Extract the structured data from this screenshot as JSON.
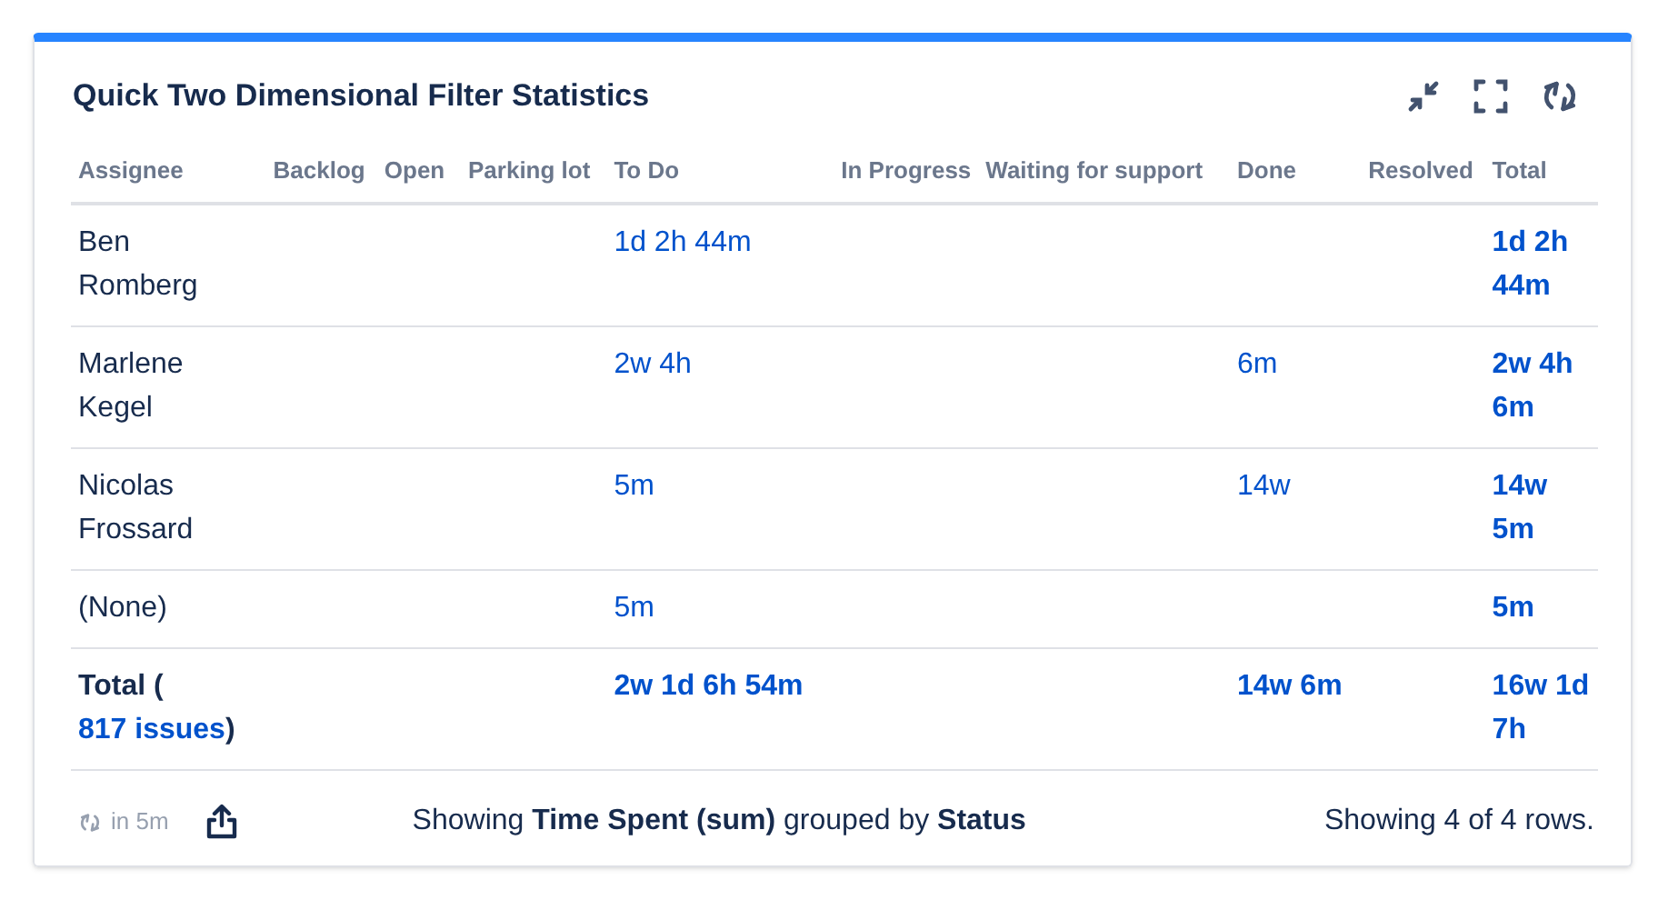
{
  "title": "Quick Two Dimensional Filter Statistics",
  "columns": [
    "Assignee",
    "Backlog",
    "Open",
    "Parking lot",
    "To Do",
    "In Progress",
    "Waiting for support",
    "Done",
    "Resolved",
    "Total"
  ],
  "rows": [
    {
      "assignee": "Ben Romberg",
      "cells": [
        null,
        null,
        null,
        "1d 2h 44m",
        null,
        null,
        null,
        null,
        "1d 2h 44m"
      ]
    },
    {
      "assignee": "Marlene Kegel",
      "cells": [
        null,
        null,
        null,
        "2w 4h",
        null,
        null,
        "6m",
        null,
        "2w 4h 6m"
      ]
    },
    {
      "assignee": "Nicolas Frossard",
      "cells": [
        null,
        null,
        null,
        "5m",
        null,
        null,
        "14w",
        null,
        "14w 5m"
      ]
    },
    {
      "assignee": "(None)",
      "cells": [
        null,
        null,
        null,
        "5m",
        null,
        null,
        null,
        null,
        "5m"
      ]
    }
  ],
  "total_row": {
    "label": "Total (",
    "link": "817 issues",
    "label_end": ")",
    "cells": [
      null,
      null,
      null,
      "2w 1d 6h 54m",
      null,
      null,
      "14w 6m",
      null,
      "16w 1d 7h"
    ]
  },
  "footer": {
    "refresh": "in 5m",
    "summary": "Showing **Time Spent (sum)** grouped by **Status**",
    "count": "Showing 4 of 4 rows."
  }
}
